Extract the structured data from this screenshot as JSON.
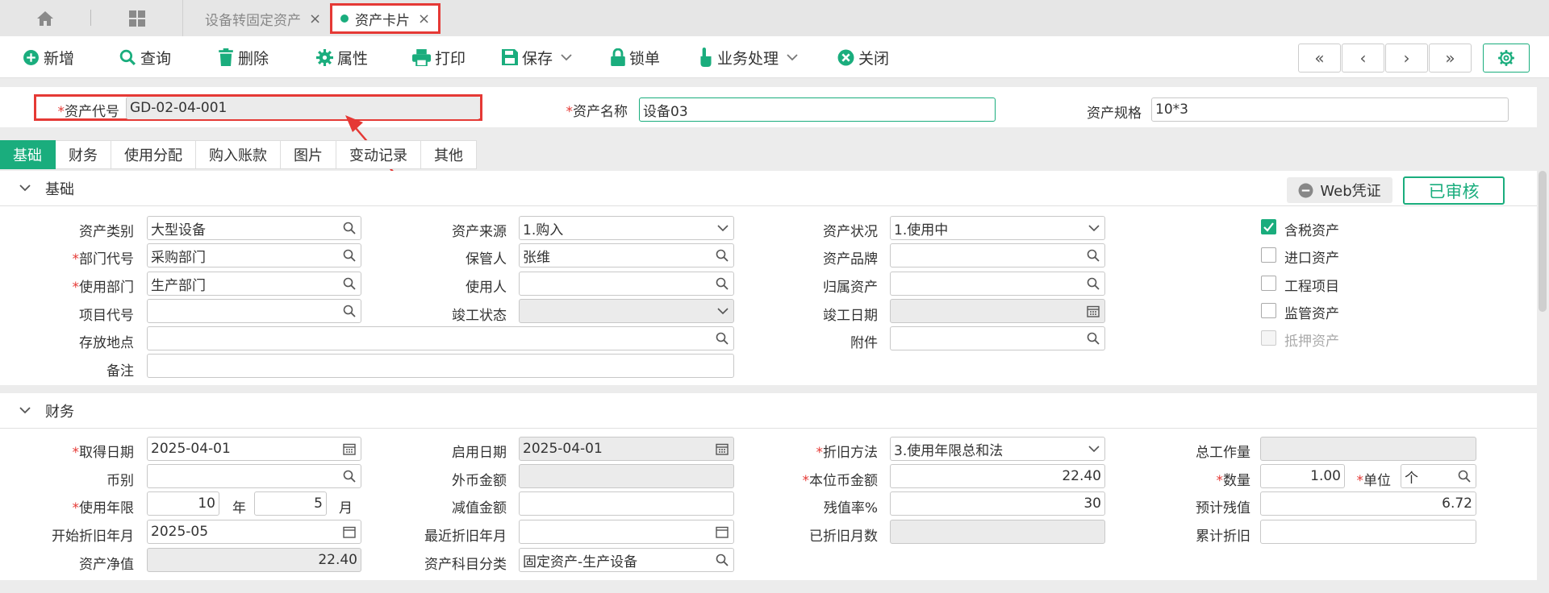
{
  "tabs": {
    "doc_tab_1": "设备转固定资产",
    "doc_tab_2": "资产卡片"
  },
  "toolbar": {
    "new": "新增",
    "query": "查询",
    "delete": "删除",
    "properties": "属性",
    "print": "打印",
    "save": "保存",
    "lock": "锁单",
    "business": "业务处理",
    "close": "关闭"
  },
  "header": {
    "asset_code_label": "资产代号",
    "asset_code": "GD-02-04-001",
    "asset_name_label": "资产名称",
    "asset_name": "设备03",
    "asset_spec_label": "资产规格",
    "asset_spec": "10*3"
  },
  "section_tabs": [
    "基础",
    "财务",
    "使用分配",
    "购入账款",
    "图片",
    "变动记录",
    "其他"
  ],
  "basic": {
    "title": "基础",
    "web_voucher": "Web凭证",
    "status": "已审核",
    "asset_category_label": "资产类别",
    "asset_category": "大型设备",
    "asset_source_label": "资产来源",
    "asset_source": "1.购入",
    "asset_status_label": "资产状况",
    "asset_status": "1.使用中",
    "dept_code_label": "部门代号",
    "dept_code": "采购部门",
    "custodian_label": "保管人",
    "custodian": "张维",
    "brand_label": "资产品牌",
    "brand": "",
    "use_dept_label": "使用部门",
    "use_dept": "生产部门",
    "user_label": "使用人",
    "user": "",
    "belong_asset_label": "归属资产",
    "belong_asset": "",
    "project_code_label": "项目代号",
    "project_code": "",
    "completion_status_label": "竣工状态",
    "completion_status": "",
    "completion_date_label": "竣工日期",
    "completion_date": "",
    "location_label": "存放地点",
    "location": "",
    "attachment_label": "附件",
    "attachment": "",
    "remark_label": "备注",
    "remark": "",
    "checkboxes": [
      {
        "label": "含税资产",
        "checked": true
      },
      {
        "label": "进口资产",
        "checked": false
      },
      {
        "label": "工程项目",
        "checked": false
      },
      {
        "label": "监管资产",
        "checked": false
      },
      {
        "label": "抵押资产",
        "checked": false
      }
    ]
  },
  "finance": {
    "title": "财务",
    "acq_date_label": "取得日期",
    "acq_date": "2025-04-01",
    "start_date_label": "启用日期",
    "start_date": "2025-04-01",
    "depr_method_label": "折旧方法",
    "depr_method": "3.使用年限总和法",
    "total_workload_label": "总工作量",
    "total_workload": "",
    "currency_label": "币别",
    "currency": "",
    "foreign_amount_label": "外币金额",
    "foreign_amount": "",
    "local_amount_label": "本位币金额",
    "local_amount": "22.40",
    "quantity_label": "数量",
    "quantity": "1.00",
    "unit_label": "单位",
    "unit": "个",
    "life_label": "使用年限",
    "life_years": "10",
    "year_unit": "年",
    "life_months": "5",
    "month_unit": "月",
    "impairment_label": "减值金额",
    "impairment": "",
    "residual_rate_label": "残值率%",
    "residual_rate": "30",
    "est_residual_label": "预计残值",
    "est_residual": "6.72",
    "depr_start_label": "开始折旧年月",
    "depr_start": "2025-05",
    "last_depr_label": "最近折旧年月",
    "last_depr": "",
    "depr_months_label": "已折旧月数",
    "depr_months": "",
    "accum_depr_label": "累计折旧",
    "accum_depr": "",
    "net_value_label": "资产净值",
    "net_value": "22.40",
    "subject_label": "资产科目分类",
    "subject": "固定资产-生产设备"
  }
}
